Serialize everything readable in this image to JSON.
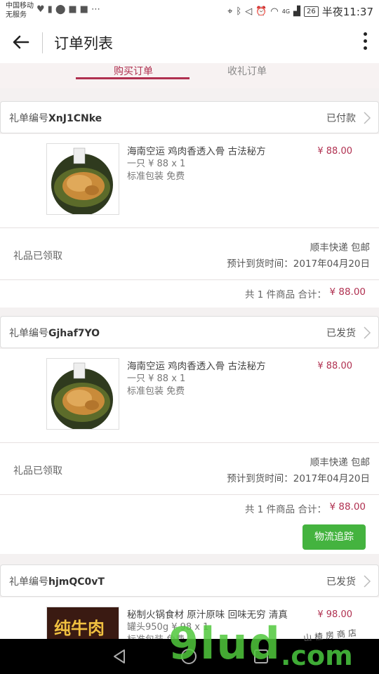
{
  "status_bar": {
    "carrier_line1": "中国移动",
    "carrier_line2": "无服务",
    "left_icons": [
      "heart-icon",
      "alert-icon",
      "map-pin-icon",
      "app-badge-icon",
      "app-icon",
      "more-dots-icon"
    ],
    "right_icons": [
      "location-icon",
      "bluetooth-icon",
      "mute-icon",
      "alarm-icon",
      "wifi-icon",
      "signal-icon"
    ],
    "network": "4G",
    "battery": "26",
    "time": "半夜11:37"
  },
  "app_bar": {
    "title": "订单列表",
    "back_icon": "arrow-left-icon",
    "menu_icon": "more-vertical-icon"
  },
  "tabs": [
    {
      "label": "购买订单",
      "active": true
    },
    {
      "label": "收礼订单",
      "active": false
    }
  ],
  "accent_color": "#b03050",
  "button_color": "#44b33f",
  "orders": [
    {
      "number_prefix": "礼单编号",
      "number": "XnJ1CNke",
      "status": "已付款",
      "product": {
        "name": "海南空运 鸡肉香透入骨 古法秘方",
        "spec": "一只 ¥ 88 x 1",
        "pack": "标准包装 免费",
        "price": "¥ 88.00"
      },
      "gift_status": "礼品已领取",
      "shipping": "顺丰快递 包邮",
      "eta": "预计到货时间：2017年04月20日",
      "total_label": "共 1 件商品 合计：",
      "total": "¥ 88.00"
    },
    {
      "number_prefix": "礼单编号",
      "number": "Gjhaf7YO",
      "status": "已发货",
      "product": {
        "name": "海南空运 鸡肉香透入骨 古法秘方",
        "spec": "一只 ¥ 88 x 1",
        "pack": "标准包装 免费",
        "price": "¥ 88.00"
      },
      "gift_status": "礼品已领取",
      "shipping": "顺丰快递 包邮",
      "eta": "预计到货时间：2017年04月20日",
      "total_label": "共 1 件商品 合计：",
      "total": "¥ 88.00",
      "track_button": "物流追踪"
    },
    {
      "number_prefix": "礼单编号",
      "number": "hjmQC0vT",
      "status": "已发货",
      "product": {
        "name": "秘制火锅食材 原汁原味 回味无穷 清真",
        "spec": "罐头950g ¥ 98 x 1",
        "pack": "标准包装 免费",
        "price": "¥ 98.00",
        "thumb_text": "纯牛肉"
      }
    }
  ],
  "watermark": {
    "text": "9lud",
    "suffix": ".com",
    "sub": "山楂房商店"
  }
}
